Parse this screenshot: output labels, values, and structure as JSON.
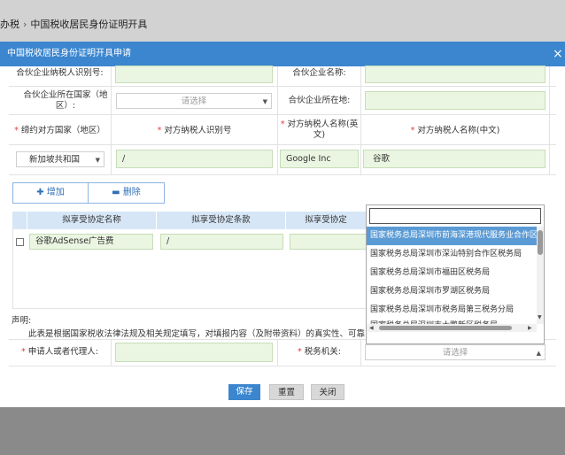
{
  "breadcrumb": {
    "home": "办税",
    "separator": "›",
    "current": "中国税收居民身份证明开具"
  },
  "dialog": {
    "title": "中国税收居民身份证明开具申请",
    "close": "×"
  },
  "form": {
    "partner_taxid_label": "合伙企业纳税人识别号:",
    "partner_name_label": "合伙企业名称:",
    "partner_country_label": "合伙企业所在国家（地区）:",
    "partner_country_placeholder": "请选择",
    "partner_location_label": "合伙企业所在地:"
  },
  "treaty": {
    "headers": [
      {
        "label": "缔约对方国家（地区）",
        "required": true
      },
      {
        "label": "对方纳税人识别号",
        "required": true
      },
      {
        "label": "对方纳税人名称(英文)",
        "required": true
      },
      {
        "label": "对方纳税人名称(中文)",
        "required": true
      }
    ],
    "row": {
      "country": "新加坡共和国",
      "taxid": "/",
      "name_en": "Google Inc",
      "name_cn": "谷歌"
    }
  },
  "buttons": {
    "add": "增加",
    "delete": "删除",
    "save": "保存",
    "reset": "重置",
    "close": "关闭"
  },
  "agreement_table": {
    "headers": [
      "拟享受协定名称",
      "拟享受协定条款",
      "拟享受协定"
    ],
    "row": {
      "name": "谷歌AdSense广告费",
      "clause": "/"
    }
  },
  "statement": {
    "title": "声明:",
    "text": "此表是根据国家税收法律法规及相关规定填写，对填报内容（及附带资料）的真实性、可靠性"
  },
  "bottom": {
    "applicant_label": "申请人或者代理人:",
    "tax_office_label": "税务机关:",
    "tax_office_placeholder": "请选择"
  },
  "dropdown": {
    "search_value": "",
    "options": [
      "国家税务总局深圳市前海深港现代服务业合作区税务局",
      "国家税务总局深圳市深汕特别合作区税务局",
      "国家税务总局深圳市福田区税务局",
      "国家税务总局深圳市罗湖区税务局",
      "国家税务总局深圳市税务局第三税务分局",
      "国家税务总局深圳市大鹏新区税务局"
    ]
  },
  "colors": {
    "title_bar": "#3b86cf",
    "save_button": "#3b86cf",
    "input_bg": "#eaf6e2",
    "selected_option": "#5b9bd5",
    "required": "#e23b3b"
  }
}
